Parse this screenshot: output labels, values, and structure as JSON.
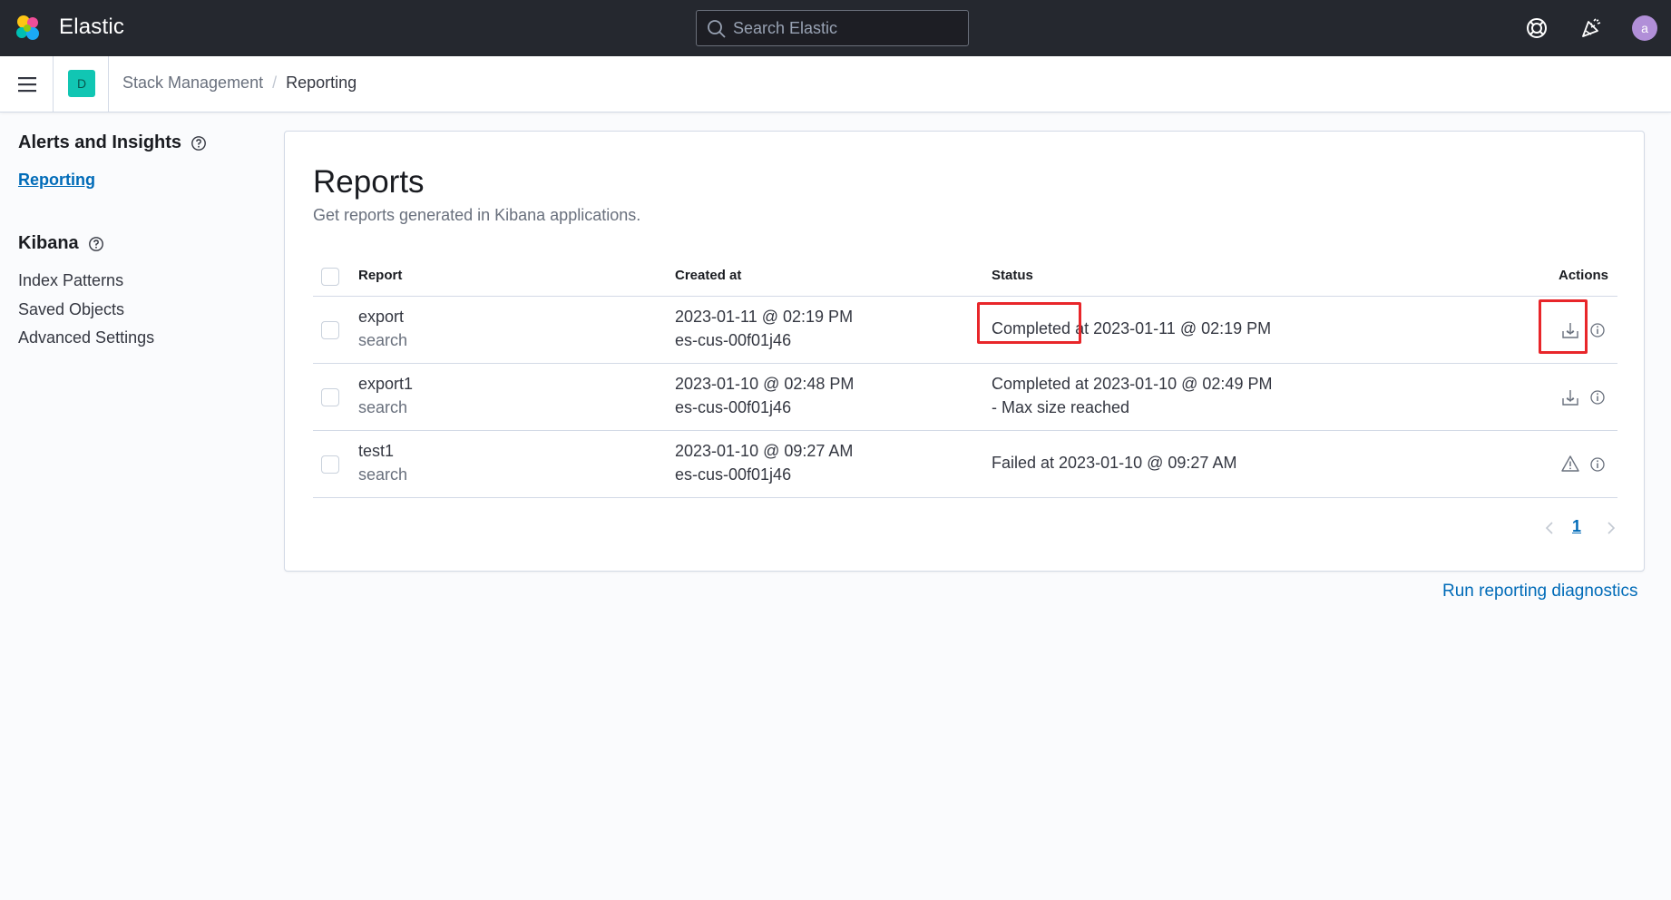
{
  "header": {
    "brand": "Elastic",
    "search_placeholder": "Search Elastic",
    "avatar_initial": "a",
    "icons": [
      "elastic-logo",
      "search-icon",
      "help-lifebuoy-icon",
      "newsfeed-icon"
    ]
  },
  "subheader": {
    "space_badge": "D",
    "breadcrumbs": [
      "Stack Management",
      "Reporting"
    ]
  },
  "sidenav": {
    "sections": [
      {
        "title": "Alerts and Insights",
        "items": [
          "Reporting"
        ],
        "active": "Reporting"
      },
      {
        "title": "Kibana",
        "items": [
          "Index Patterns",
          "Saved Objects",
          "Advanced Settings"
        ]
      }
    ]
  },
  "main": {
    "title": "Reports",
    "description": "Get reports generated in Kibana applications.",
    "table": {
      "columns": [
        "Report",
        "Created at",
        "Status",
        "Actions"
      ],
      "rows": [
        {
          "report": "export",
          "type": "search",
          "created_at": "2023-01-11 @ 02:19 PM",
          "created_by": "es-cus-00f01j46",
          "status_label": "Completed",
          "status_rest": "at 2023-01-11 @ 02:19 PM",
          "status_line2": "",
          "action_icon": "download-icon"
        },
        {
          "report": "export1",
          "type": "search",
          "created_at": "2023-01-10 @ 02:48 PM",
          "created_by": "es-cus-00f01j46",
          "status_label": "Completed at 2023-01-10 @ 02:49 PM",
          "status_rest": "",
          "status_line2": "- Max size reached",
          "action_icon": "download-icon"
        },
        {
          "report": "test1",
          "type": "search",
          "created_at": "2023-01-10 @ 09:27 AM",
          "created_by": "es-cus-00f01j46",
          "status_label": "Failed at 2023-01-10 @ 09:27 AM",
          "status_rest": "",
          "status_line2": "",
          "action_icon": "warning-icon"
        }
      ]
    },
    "pagination": {
      "current_page": "1"
    },
    "diagnostics_link": "Run reporting diagnostics"
  },
  "colors": {
    "header_bg": "#25282f",
    "link": "#006bb8",
    "highlight": "#e8262a",
    "space_badge": "#11c6b3",
    "avatar": "#b18fd8"
  }
}
